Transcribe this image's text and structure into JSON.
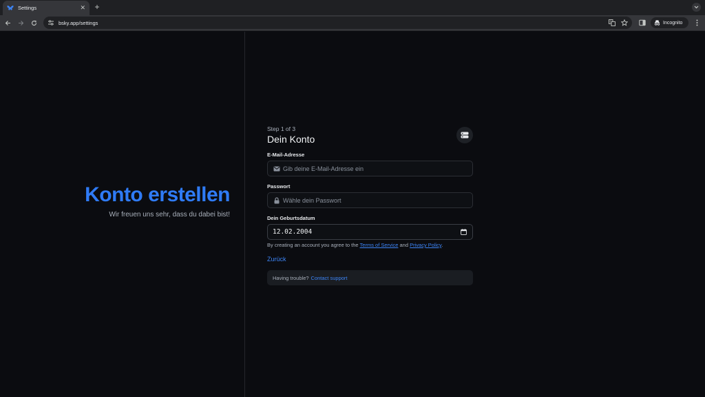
{
  "browser": {
    "tab_title": "Settings",
    "url": "bsky.app/settings",
    "incognito_label": "Incognito"
  },
  "left": {
    "title": "Konto erstellen",
    "subtitle": "Wir freuen uns sehr, dass du dabei bist!"
  },
  "form": {
    "step": "Step 1 of 3",
    "title": "Dein Konto",
    "email": {
      "label": "E-Mail-Adresse",
      "placeholder": "Gib deine E-Mail-Adresse ein"
    },
    "password": {
      "label": "Passwort",
      "placeholder": "Wähle dein Passwort"
    },
    "birthdate": {
      "label": "Dein Geburtsdatum",
      "value": "12.02.2004"
    },
    "terms_prefix": "By creating an account you agree to the",
    "terms_link": "Terms of Service",
    "terms_and": "and",
    "privacy_link": "Privacy Policy",
    "terms_suffix": ".",
    "back": "Zurück",
    "support_prefix": "Having trouble?",
    "support_link": "Contact support"
  },
  "colors": {
    "accent": "#2f7bf6",
    "background": "#0b0c10"
  }
}
